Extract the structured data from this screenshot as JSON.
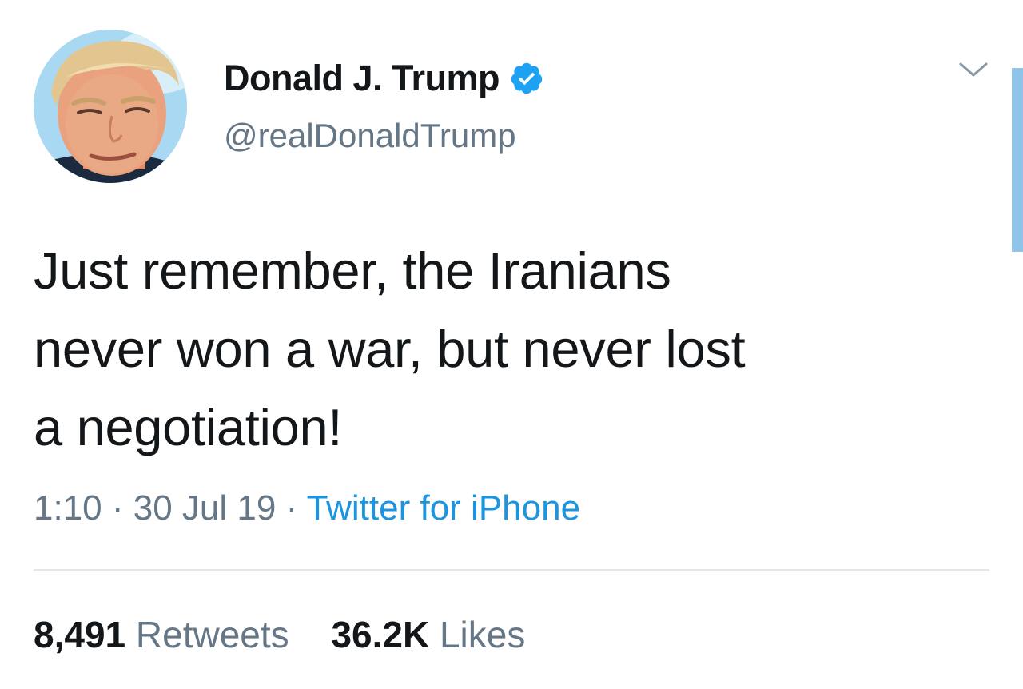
{
  "tweet": {
    "author": {
      "display_name": "Donald J. Trump",
      "handle": "@realDonaldTrump",
      "verified": true
    },
    "text_lines": [
      "Just remember, the Iranians",
      "never won a war, but never lost",
      "a negotiation!"
    ],
    "meta": {
      "time": "1:10",
      "separator": "·",
      "date": "30 Jul 19",
      "source": "Twitter for iPhone"
    },
    "stats": {
      "retweets_count": "8,491",
      "retweets_label": "Retweets",
      "likes_count": "36.2K",
      "likes_label": "Likes"
    }
  },
  "colors": {
    "text_primary": "#14171a",
    "text_secondary": "#657786",
    "link_blue": "#1b95e0",
    "verified_blue": "#1da1f2",
    "divider": "#e1e8ed",
    "scrollbar": "#8fc3e7"
  },
  "icons": {
    "verified": "verified-badge-icon",
    "more": "chevron-down-icon"
  }
}
